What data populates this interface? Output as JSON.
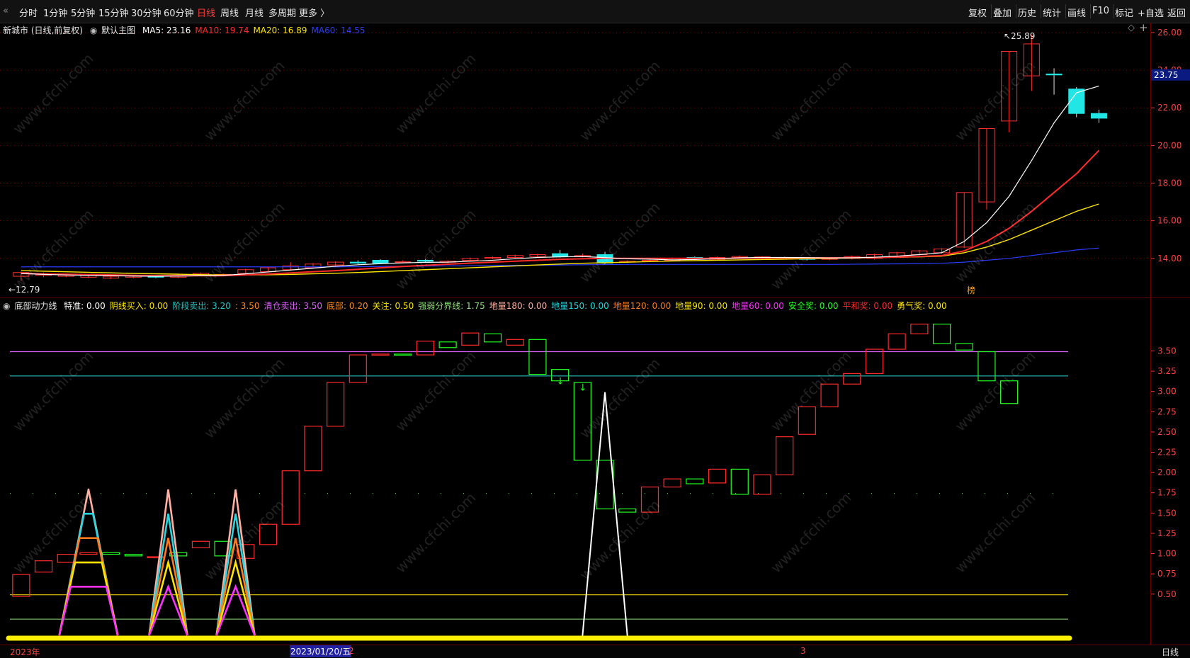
{
  "toolbar": {
    "left_items": [
      "分时",
      "1分钟",
      "5分钟",
      "15分钟",
      "30分钟",
      "60分钟",
      "日线",
      "周线",
      "月线",
      "多周期",
      "更多 〉"
    ],
    "active_index": 6,
    "right_items": [
      "复权",
      "叠加",
      "历史",
      "统计",
      "画线",
      "F10",
      "标记",
      "+自选",
      "返回"
    ]
  },
  "main": {
    "title": "新城市 (日线,前复权)",
    "template": "默认主图",
    "ma": [
      {
        "label": "MA5:",
        "value": "23.16",
        "color": "#ffffff"
      },
      {
        "label": "MA10:",
        "value": "19.74",
        "color": "#ff2a2a"
      },
      {
        "label": "MA20:",
        "value": "16.89",
        "color": "#ffe400"
      },
      {
        "label": "MA60:",
        "value": "14.55",
        "color": "#2c3cff"
      }
    ],
    "high_label": "25.89",
    "low_label": "←12.79",
    "marker_char": "榜",
    "diamond": "◇",
    "plus": "+"
  },
  "price_axis": {
    "ticks": [
      "26.00",
      "24.00",
      "22.00",
      "20.00",
      "18.00",
      "16.00",
      "14.00"
    ],
    "current": "23.75"
  },
  "indicator": {
    "name": "底部动力线",
    "params": [
      {
        "label": "特准:",
        "value": "0.00",
        "color": "#ffffff"
      },
      {
        "label": "阴线买入:",
        "value": "0.00",
        "color": "#ffe400"
      },
      {
        "label": "阶段卖出:",
        "value": "3.20",
        "color": "#27c6c6"
      },
      {
        "label": ":",
        "value": "3.50",
        "color": "#ff8a1a"
      },
      {
        "label": "清仓卖出:",
        "value": "3.50",
        "color": "#e060ff"
      },
      {
        "label": "底部:",
        "value": "0.20",
        "color": "#ff8a1a"
      },
      {
        "label": "关注:",
        "value": "0.50",
        "color": "#ffe400"
      },
      {
        "label": "强弱分界线:",
        "value": "1.75",
        "color": "#8ee07a"
      },
      {
        "label": "地量180:",
        "value": "0.00",
        "color": "#ffb0a0"
      },
      {
        "label": "地量150:",
        "value": "0.00",
        "color": "#27d6e0"
      },
      {
        "label": "地量120:",
        "value": "0.00",
        "color": "#ff7a1a"
      },
      {
        "label": "地量90:",
        "value": "0.00",
        "color": "#ffe400"
      },
      {
        "label": "地量60:",
        "value": "0.00",
        "color": "#ff30ff"
      },
      {
        "label": "安全奖:",
        "value": "0.00",
        "color": "#22ff22"
      },
      {
        "label": "平和奖:",
        "value": "0.00",
        "color": "#ff2a2a"
      },
      {
        "label": "勇气奖:",
        "value": "0.00",
        "color": "#ffe400"
      }
    ]
  },
  "ind_axis": {
    "ticks": [
      "3.50",
      "3.25",
      "3.00",
      "2.75",
      "2.50",
      "2.25",
      "2.00",
      "1.75",
      "1.50",
      "1.25",
      "1.00",
      "0.75",
      "0.50"
    ]
  },
  "bottom": {
    "year_label": "2023年",
    "date_label": "2023/01/20/五",
    "month2": "2",
    "month3": "3",
    "period": "日线"
  },
  "watermark": "www.cfchi.com",
  "chart_data": {
    "type": "candlestick",
    "price_candles": [
      {
        "o": 13.05,
        "c": 13.25,
        "h": 13.3,
        "l": 12.79
      },
      {
        "o": 13.1,
        "c": 13.15,
        "h": 13.25,
        "l": 13.0
      },
      {
        "o": 13.05,
        "c": 13.12,
        "h": 13.2,
        "l": 13.0
      },
      {
        "o": 13.0,
        "c": 13.1,
        "h": 13.15,
        "l": 12.95
      },
      {
        "o": 12.95,
        "c": 13.05,
        "h": 13.1,
        "l": 12.9
      },
      {
        "o": 13.0,
        "c": 13.08,
        "h": 13.12,
        "l": 12.95
      },
      {
        "o": 13.05,
        "c": 13.0,
        "h": 13.1,
        "l": 12.95
      },
      {
        "o": 13.0,
        "c": 13.1,
        "h": 13.15,
        "l": 12.95
      },
      {
        "o": 13.1,
        "c": 13.2,
        "h": 13.25,
        "l": 13.05
      },
      {
        "o": 13.1,
        "c": 13.15,
        "h": 13.2,
        "l": 13.05
      },
      {
        "o": 13.2,
        "c": 13.4,
        "h": 13.45,
        "l": 13.15
      },
      {
        "o": 13.3,
        "c": 13.5,
        "h": 13.55,
        "l": 13.25
      },
      {
        "o": 13.4,
        "c": 13.6,
        "h": 13.8,
        "l": 13.35
      },
      {
        "o": 13.5,
        "c": 13.7,
        "h": 13.75,
        "l": 13.45
      },
      {
        "o": 13.65,
        "c": 13.8,
        "h": 13.85,
        "l": 13.6
      },
      {
        "o": 13.8,
        "c": 13.75,
        "h": 13.9,
        "l": 13.7
      },
      {
        "o": 13.9,
        "c": 13.75,
        "h": 13.95,
        "l": 13.7
      },
      {
        "o": 13.8,
        "c": 13.82,
        "h": 13.9,
        "l": 13.75
      },
      {
        "o": 13.9,
        "c": 13.85,
        "h": 13.95,
        "l": 13.8
      },
      {
        "o": 13.8,
        "c": 13.85,
        "h": 13.9,
        "l": 13.75
      },
      {
        "o": 13.9,
        "c": 14.0,
        "h": 14.05,
        "l": 13.85
      },
      {
        "o": 14.0,
        "c": 14.05,
        "h": 14.1,
        "l": 13.95
      },
      {
        "o": 14.05,
        "c": 14.15,
        "h": 14.2,
        "l": 14.0
      },
      {
        "o": 14.1,
        "c": 14.2,
        "h": 14.25,
        "l": 14.05
      },
      {
        "o": 14.25,
        "c": 14.1,
        "h": 14.45,
        "l": 14.05
      },
      {
        "o": 14.1,
        "c": 14.15,
        "h": 14.25,
        "l": 14.05
      },
      {
        "o": 14.2,
        "c": 13.75,
        "h": 14.35,
        "l": 13.7
      },
      {
        "o": 13.8,
        "c": 13.85,
        "h": 13.9,
        "l": 13.75
      },
      {
        "o": 13.85,
        "c": 13.9,
        "h": 13.95,
        "l": 13.8
      },
      {
        "o": 13.9,
        "c": 14.0,
        "h": 14.05,
        "l": 13.85
      },
      {
        "o": 14.05,
        "c": 14.0,
        "h": 14.1,
        "l": 13.95
      },
      {
        "o": 13.95,
        "c": 14.05,
        "h": 14.1,
        "l": 13.9
      },
      {
        "o": 14.05,
        "c": 14.1,
        "h": 14.15,
        "l": 14.0
      },
      {
        "o": 14.0,
        "c": 14.08,
        "h": 14.12,
        "l": 13.95
      },
      {
        "o": 14.0,
        "c": 14.05,
        "h": 14.1,
        "l": 13.95
      },
      {
        "o": 14.0,
        "c": 13.95,
        "h": 14.05,
        "l": 13.9
      },
      {
        "o": 13.95,
        "c": 14.0,
        "h": 14.05,
        "l": 13.9
      },
      {
        "o": 14.0,
        "c": 14.1,
        "h": 14.15,
        "l": 13.95
      },
      {
        "o": 14.0,
        "c": 14.2,
        "h": 14.25,
        "l": 13.95
      },
      {
        "o": 14.1,
        "c": 14.3,
        "h": 14.35,
        "l": 14.05
      },
      {
        "o": 14.2,
        "c": 14.4,
        "h": 14.45,
        "l": 14.15
      },
      {
        "o": 14.3,
        "c": 14.5,
        "h": 14.55,
        "l": 14.25
      },
      {
        "o": 14.6,
        "c": 17.5,
        "h": 17.5,
        "l": 14.55
      },
      {
        "o": 17.0,
        "c": 20.9,
        "h": 20.9,
        "l": 16.6
      },
      {
        "o": 21.3,
        "c": 25.0,
        "h": 25.0,
        "l": 20.7
      },
      {
        "o": 23.7,
        "c": 25.4,
        "h": 25.89,
        "l": 22.9
      },
      {
        "o": 23.8,
        "c": 23.75,
        "h": 24.1,
        "l": 22.7
      },
      {
        "o": 23.0,
        "c": 21.7,
        "h": 23.1,
        "l": 21.5
      },
      {
        "o": 21.7,
        "c": 21.45,
        "h": 21.9,
        "l": 21.2
      }
    ],
    "ma5": [
      13.2,
      13.15,
      13.12,
      13.1,
      13.08,
      13.06,
      13.05,
      13.06,
      13.08,
      13.1,
      13.18,
      13.28,
      13.38,
      13.48,
      13.58,
      13.66,
      13.72,
      13.76,
      13.79,
      13.8,
      13.85,
      13.9,
      13.98,
      14.05,
      14.08,
      14.1,
      14.04,
      13.98,
      13.96,
      13.92,
      13.94,
      13.98,
      14.03,
      14.05,
      14.05,
      14.04,
      14.02,
      14.03,
      14.06,
      14.12,
      14.2,
      14.3,
      14.9,
      15.9,
      17.3,
      19.2,
      21.2,
      22.8,
      23.16
    ],
    "ma10": [
      13.2,
      13.18,
      13.16,
      13.14,
      13.12,
      13.1,
      13.09,
      13.08,
      13.08,
      13.08,
      13.12,
      13.17,
      13.23,
      13.29,
      13.35,
      13.42,
      13.5,
      13.57,
      13.63,
      13.69,
      13.75,
      13.8,
      13.85,
      13.9,
      13.95,
      13.98,
      14.0,
      14.0,
      14.0,
      14.0,
      14.0,
      14.0,
      14.01,
      14.02,
      14.03,
      14.03,
      14.03,
      14.04,
      14.05,
      14.07,
      14.1,
      14.15,
      14.4,
      14.9,
      15.6,
      16.5,
      17.5,
      18.5,
      19.74
    ],
    "ma20": [
      13.35,
      13.32,
      13.29,
      13.26,
      13.23,
      13.2,
      13.18,
      13.16,
      13.14,
      13.12,
      13.12,
      13.13,
      13.15,
      13.18,
      13.21,
      13.25,
      13.3,
      13.35,
      13.4,
      13.45,
      13.5,
      13.55,
      13.6,
      13.65,
      13.7,
      13.74,
      13.77,
      13.8,
      13.83,
      13.86,
      13.88,
      13.9,
      13.92,
      13.94,
      13.96,
      13.98,
      14.0,
      14.02,
      14.04,
      14.06,
      14.08,
      14.12,
      14.3,
      14.6,
      15.0,
      15.5,
      16.0,
      16.5,
      16.89
    ],
    "ma60": [
      13.55,
      13.55,
      13.55,
      13.55,
      13.55,
      13.55,
      13.55,
      13.55,
      13.55,
      13.55,
      13.55,
      13.55,
      13.55,
      13.55,
      13.55,
      13.56,
      13.57,
      13.58,
      13.59,
      13.6,
      13.61,
      13.62,
      13.63,
      13.64,
      13.65,
      13.66,
      13.67,
      13.68,
      13.68,
      13.68,
      13.68,
      13.68,
      13.68,
      13.68,
      13.68,
      13.68,
      13.68,
      13.69,
      13.7,
      13.71,
      13.72,
      13.74,
      13.8,
      13.9,
      14.0,
      14.15,
      14.3,
      14.45,
      14.55
    ],
    "ind_candles": [
      {
        "o": 0.48,
        "c": 0.75,
        "up": true
      },
      {
        "o": 0.78,
        "c": 0.92,
        "up": true
      },
      {
        "o": 0.9,
        "c": 1.0,
        "up": true
      },
      {
        "o": 1.0,
        "c": 1.02,
        "up": true
      },
      {
        "o": 1.0,
        "c": 1.02,
        "up": false
      },
      {
        "o": 1.0,
        "c": 0.98,
        "up": false
      },
      {
        "o": 0.97,
        "c": 0.97,
        "up": true
      },
      {
        "o": 1.02,
        "c": 0.98,
        "up": false
      },
      {
        "o": 1.08,
        "c": 1.16,
        "up": true
      },
      {
        "o": 1.16,
        "c": 0.98,
        "up": false
      },
      {
        "o": 0.95,
        "c": 1.12,
        "up": true
      },
      {
        "o": 1.12,
        "c": 1.37,
        "up": true
      },
      {
        "o": 1.37,
        "c": 2.03,
        "up": true
      },
      {
        "o": 2.03,
        "c": 2.58,
        "up": true
      },
      {
        "o": 2.58,
        "c": 3.12,
        "up": true
      },
      {
        "o": 3.12,
        "c": 3.46,
        "up": true
      },
      {
        "o": 3.46,
        "c": 3.47,
        "up": true
      },
      {
        "o": 3.46,
        "c": 3.47,
        "up": false
      },
      {
        "o": 3.46,
        "c": 3.63,
        "up": true
      },
      {
        "o": 3.55,
        "c": 3.62,
        "up": false
      },
      {
        "o": 3.58,
        "c": 3.73,
        "up": true
      },
      {
        "o": 3.72,
        "c": 3.62,
        "up": false
      },
      {
        "o": 3.58,
        "c": 3.65,
        "up": true
      },
      {
        "o": 3.65,
        "c": 3.22,
        "up": false
      },
      {
        "o": 3.28,
        "c": 3.14,
        "up": false
      },
      {
        "o": 3.12,
        "c": 2.16,
        "up": false
      },
      {
        "o": 2.16,
        "c": 1.56,
        "up": false
      },
      {
        "o": 1.56,
        "c": 1.52,
        "up": false
      },
      {
        "o": 1.52,
        "c": 1.83,
        "up": true
      },
      {
        "o": 1.83,
        "c": 1.93,
        "up": true
      },
      {
        "o": 1.93,
        "c": 1.87,
        "up": false
      },
      {
        "o": 1.88,
        "c": 2.05,
        "up": true
      },
      {
        "o": 2.05,
        "c": 1.74,
        "up": false
      },
      {
        "o": 1.74,
        "c": 1.98,
        "up": true
      },
      {
        "o": 1.98,
        "c": 2.45,
        "up": true
      },
      {
        "o": 2.48,
        "c": 2.82,
        "up": true
      },
      {
        "o": 2.82,
        "c": 3.1,
        "up": true
      },
      {
        "o": 3.1,
        "c": 3.23,
        "up": true
      },
      {
        "o": 3.23,
        "c": 3.53,
        "up": true
      },
      {
        "o": 3.53,
        "c": 3.72,
        "up": true
      },
      {
        "o": 3.72,
        "c": 3.84,
        "up": true
      },
      {
        "o": 3.84,
        "c": 3.6,
        "up": false
      },
      {
        "o": 3.6,
        "c": 3.52,
        "up": false
      },
      {
        "o": 3.5,
        "c": 3.14,
        "up": false
      },
      {
        "o": 3.14,
        "c": 2.86,
        "up": false
      }
    ],
    "lines": {
      "clear_sell": 3.5,
      "stage_sell": 3.2,
      "strong_weak": 1.75,
      "focus": 0.5,
      "bottom": 0.2
    },
    "y_price": [
      12.6,
      26.3
    ],
    "y_ind": [
      0.0,
      3.95
    ]
  }
}
